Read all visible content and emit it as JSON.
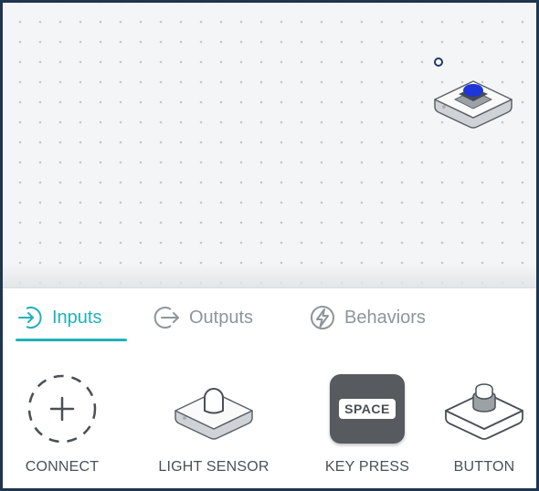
{
  "canvas": {
    "nodes": [
      {
        "type": "button",
        "handle_icon": "port-circle-icon",
        "accent": "#1e36d8"
      }
    ]
  },
  "tabs": [
    {
      "label": "Inputs",
      "icon": "arrow-into-circle-icon",
      "active": true
    },
    {
      "label": "Outputs",
      "icon": "arrow-out-of-circle-icon",
      "active": false
    },
    {
      "label": "Behaviors",
      "icon": "lightning-bolt-icon",
      "active": false
    }
  ],
  "palette": [
    {
      "label": "CONNECT",
      "icon": "plus-dashed-circle-icon"
    },
    {
      "label": "LIGHT SENSOR",
      "icon": "light-sensor-icon"
    },
    {
      "label": "KEY PRESS",
      "icon": "space-key-icon",
      "key_text": "SPACE"
    },
    {
      "label": "BUTTON",
      "icon": "button-device-icon"
    }
  ],
  "colors": {
    "accent": "#1fb2b8",
    "inactive": "#8e959b",
    "frame": "#1f3550",
    "key_tile": "#575b60"
  }
}
